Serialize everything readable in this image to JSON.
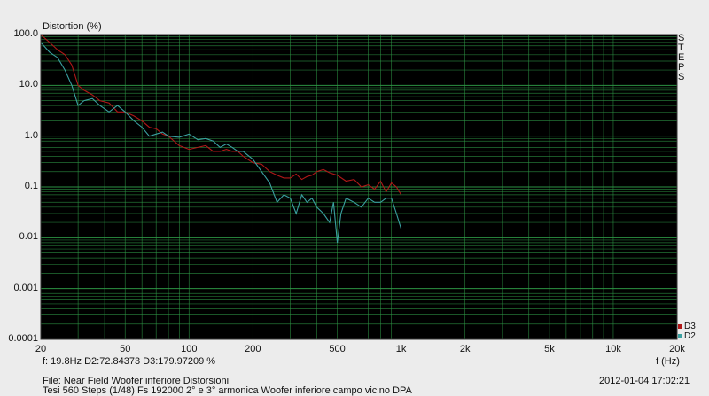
{
  "window": {
    "ylabel": "Distortion (%)",
    "xlabel": "f (Hz)",
    "side_label": "STEPS",
    "cursor_readout": "f: 19.8Hz      D2:72.84373   D3:179.97209 %",
    "file_line": "File: Near Field Woofer inferiore Distorsioni",
    "info_line": "Tesi 560  Steps (1/48) Fs 192000 2° e 3° armonica Woofer inferiore campo vicino      DPA",
    "timestamp": "2012-01-04 17:02:21"
  },
  "chart_data": {
    "type": "line",
    "title": "",
    "xlabel": "f (Hz)",
    "ylabel": "Distortion (%)",
    "xscale": "log",
    "yscale": "log",
    "xlim": [
      20,
      20000
    ],
    "ylim": [
      0.0001,
      100
    ],
    "grid": true,
    "background": "#000000",
    "grid_color": "#2f9a47",
    "legend_position": "bottom-right",
    "x_ticks": [
      "20",
      "50",
      "100",
      "200",
      "500",
      "1k",
      "2k",
      "5k",
      "10k",
      "20k"
    ],
    "x_tick_values": [
      20,
      50,
      100,
      200,
      500,
      1000,
      2000,
      5000,
      10000,
      20000
    ],
    "y_ticks": [
      "100.0",
      "10.0",
      "1.0",
      "0.1",
      "0.01",
      "0.001",
      "0.0001"
    ],
    "y_tick_values": [
      100,
      10,
      1,
      0.1,
      0.01,
      0.001,
      0.0001
    ],
    "series": [
      {
        "name": "D3",
        "color": "#b01818",
        "x": [
          20,
          22,
          24,
          26,
          28,
          30,
          32,
          35,
          38,
          42,
          46,
          50,
          55,
          60,
          65,
          70,
          75,
          80,
          90,
          100,
          110,
          120,
          130,
          140,
          150,
          160,
          170,
          180,
          200,
          220,
          240,
          260,
          280,
          300,
          320,
          340,
          360,
          380,
          400,
          430,
          460,
          500,
          550,
          600,
          650,
          700,
          750,
          800,
          850,
          900,
          950,
          1000
        ],
        "y": [
          100,
          70,
          50,
          40,
          25,
          10,
          8,
          6.5,
          5,
          4.5,
          3,
          3,
          2.5,
          2,
          1.5,
          1.4,
          1.1,
          1,
          0.65,
          0.55,
          0.6,
          0.65,
          0.5,
          0.5,
          0.55,
          0.5,
          0.5,
          0.4,
          0.3,
          0.28,
          0.2,
          0.17,
          0.15,
          0.15,
          0.18,
          0.14,
          0.16,
          0.17,
          0.2,
          0.22,
          0.19,
          0.17,
          0.13,
          0.14,
          0.1,
          0.11,
          0.09,
          0.13,
          0.08,
          0.12,
          0.1,
          0.07
        ]
      },
      {
        "name": "D2",
        "color": "#3aa0a0",
        "x": [
          20,
          22,
          24,
          26,
          28,
          30,
          32,
          35,
          38,
          42,
          46,
          50,
          55,
          60,
          65,
          70,
          75,
          80,
          90,
          100,
          110,
          120,
          130,
          140,
          150,
          160,
          170,
          180,
          200,
          220,
          240,
          260,
          280,
          300,
          320,
          340,
          360,
          380,
          400,
          430,
          460,
          480,
          500,
          520,
          550,
          600,
          650,
          700,
          750,
          800,
          850,
          900,
          950,
          1000
        ],
        "y": [
          70,
          45,
          35,
          20,
          10,
          4,
          5,
          5.5,
          4,
          3,
          4,
          3,
          2,
          1.5,
          1,
          1.1,
          1.2,
          1,
          0.95,
          1.1,
          0.85,
          0.9,
          0.8,
          0.6,
          0.7,
          0.6,
          0.5,
          0.5,
          0.35,
          0.2,
          0.12,
          0.05,
          0.07,
          0.06,
          0.03,
          0.07,
          0.05,
          0.06,
          0.04,
          0.03,
          0.02,
          0.05,
          0.008,
          0.03,
          0.06,
          0.05,
          0.04,
          0.06,
          0.05,
          0.05,
          0.06,
          0.06,
          0.03,
          0.015
        ]
      }
    ]
  }
}
